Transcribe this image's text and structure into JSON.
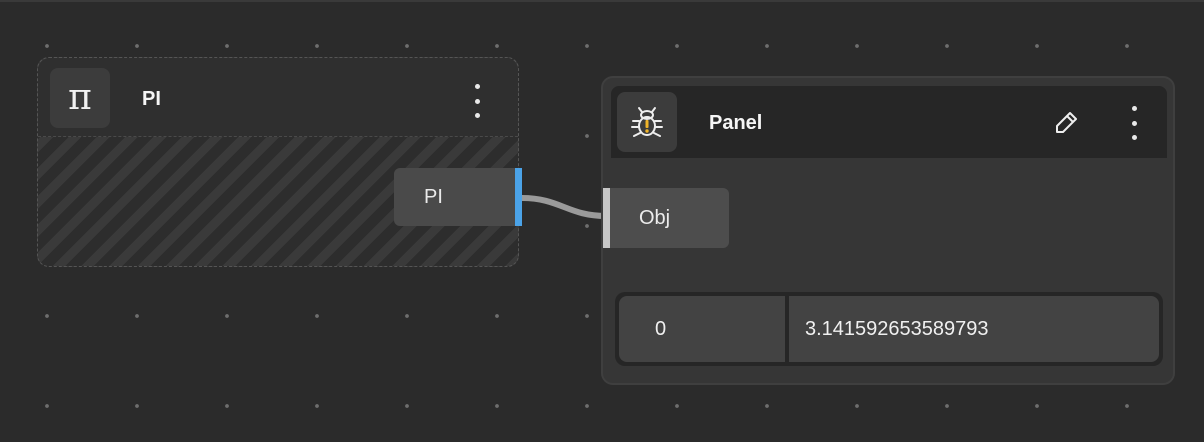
{
  "nodes": {
    "pi": {
      "title": "PI",
      "icon_glyph": "π",
      "icon": "pi-icon",
      "output_port": "PI",
      "port_color": "#4ba3e8"
    },
    "panel": {
      "title": "Panel",
      "icon": "bug-warning-icon",
      "input_port": "Obj",
      "rows": [
        {
          "index": "0",
          "value": "3.141592653589793"
        }
      ]
    }
  },
  "theme": {
    "canvas_bg": "#2b2b2b",
    "dot_color": "#6e6e6e",
    "wire_color": "#9a9a9a"
  }
}
